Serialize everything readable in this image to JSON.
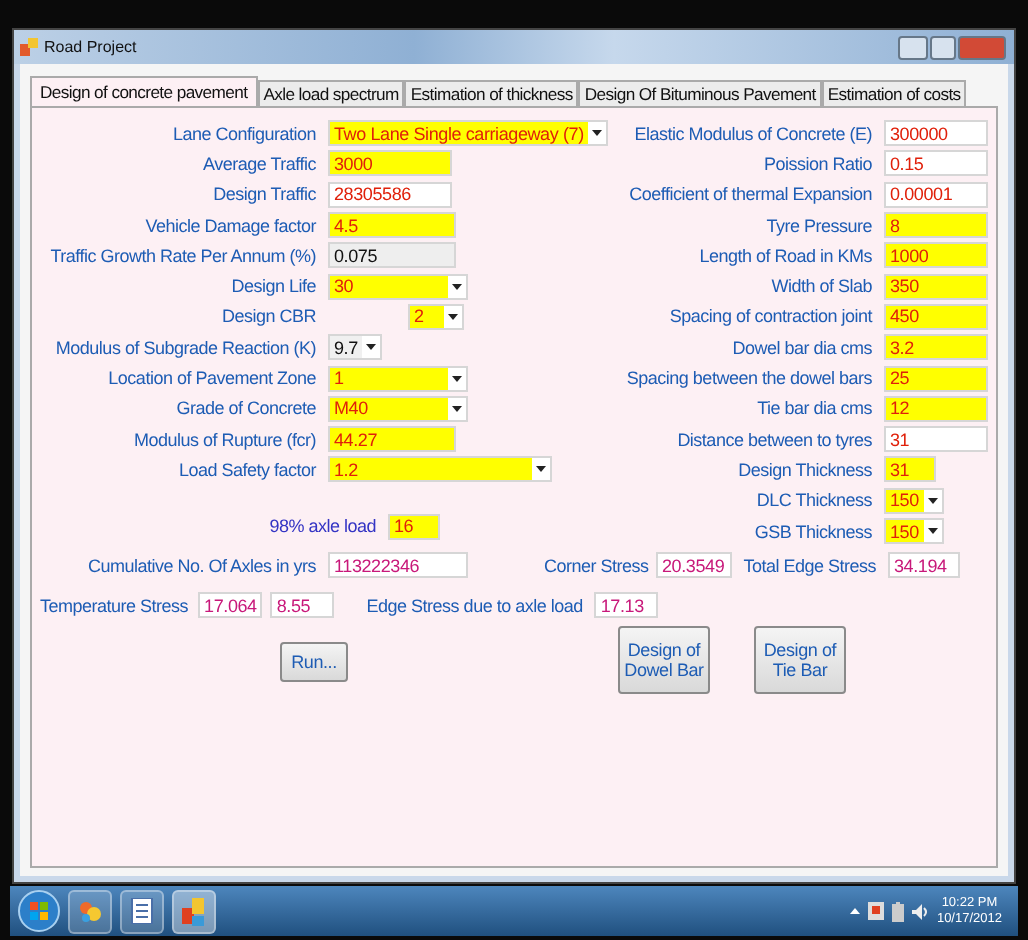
{
  "window": {
    "title": "Road Project"
  },
  "tabs": [
    {
      "label": "Design of concrete pavement",
      "selected": true
    },
    {
      "label": "Axle load spectrum",
      "selected": false
    },
    {
      "label": "Estimation of thickness",
      "selected": false
    },
    {
      "label": "Design Of Bituminous Pavement",
      "selected": false
    },
    {
      "label": "Estimation of costs",
      "selected": false
    }
  ],
  "left_fields": [
    {
      "label": "Lane Configuration",
      "value": "Two Lane Single carriageway (7)",
      "kind": "input",
      "dropdown": true
    },
    {
      "label": "Average Traffic",
      "value": "3000",
      "kind": "input",
      "dropdown": false
    },
    {
      "label": "Design Traffic",
      "value": "28305586",
      "kind": "output",
      "dropdown": false
    },
    {
      "label": "Vehicle Damage factor",
      "value": "4.5",
      "kind": "input",
      "dropdown": false
    },
    {
      "label": "Traffic Growth Rate Per Annum (%)",
      "value": "0.075",
      "kind": "readonly",
      "dropdown": false
    },
    {
      "label": "Design Life",
      "value": "30",
      "kind": "input",
      "dropdown": true
    },
    {
      "label": "Design CBR",
      "value": "2",
      "kind": "input",
      "dropdown": true
    },
    {
      "label": "Modulus of Subgrade Reaction (K)",
      "value": "9.7",
      "kind": "plain",
      "dropdown": true
    },
    {
      "label": "Location of Pavement Zone",
      "value": "1",
      "kind": "input",
      "dropdown": true
    },
    {
      "label": "Grade of Concrete",
      "value": "M40",
      "kind": "input",
      "dropdown": true
    },
    {
      "label": "Modulus of Rupture (fcr)",
      "value": "44.27",
      "kind": "input",
      "dropdown": false
    },
    {
      "label": "Load Safety factor",
      "value": "1.2",
      "kind": "input",
      "dropdown": true
    }
  ],
  "right_fields": [
    {
      "label": "Elastic Modulus of Concrete (E)",
      "value": "300000",
      "kind": "output",
      "dropdown": false
    },
    {
      "label": "Poission Ratio",
      "value": "0.15",
      "kind": "output",
      "dropdown": false
    },
    {
      "label": "Coefficient of thermal Expansion",
      "value": "0.00001",
      "kind": "output",
      "dropdown": false
    },
    {
      "label": "Tyre Pressure",
      "value": "8",
      "kind": "input",
      "dropdown": false
    },
    {
      "label": "Length of Road in KMs",
      "value": "1000",
      "kind": "input",
      "dropdown": false
    },
    {
      "label": "Width of Slab",
      "value": "350",
      "kind": "input",
      "dropdown": false
    },
    {
      "label": "Spacing of contraction joint",
      "value": "450",
      "kind": "input",
      "dropdown": false
    },
    {
      "label": "Dowel bar dia cms",
      "value": "3.2",
      "kind": "input",
      "dropdown": false
    },
    {
      "label": "Spacing between the dowel bars",
      "value": "25",
      "kind": "input",
      "dropdown": false
    },
    {
      "label": "Tie bar dia cms",
      "value": "12",
      "kind": "input",
      "dropdown": false
    },
    {
      "label": "Distance between to tyres",
      "value": "31",
      "kind": "output",
      "dropdown": false
    },
    {
      "label": "Design Thickness",
      "value": "31",
      "kind": "input",
      "dropdown": false
    },
    {
      "label": "DLC Thickness",
      "value": "150",
      "kind": "input",
      "dropdown": true
    },
    {
      "label": "GSB Thickness",
      "value": "150",
      "kind": "input",
      "dropdown": true
    }
  ],
  "axle_load": {
    "label": "98% axle load",
    "value": "16",
    "kind": "input"
  },
  "cumulative_axles": {
    "label": "Cumulative No. Of Axles in yrs",
    "value": "113222346",
    "kind": "result"
  },
  "corner_stress": {
    "label": "Corner Stress",
    "value": "20.3549",
    "kind": "result"
  },
  "total_edge_stress": {
    "label": "Total Edge Stress",
    "value": "34.194",
    "kind": "result"
  },
  "temperature_stress": {
    "label": "Temperature Stress",
    "values": [
      "17.064",
      "8.55"
    ]
  },
  "edge_stress": {
    "label": "Edge Stress due to axle load",
    "value": "17.13",
    "kind": "result"
  },
  "buttons": [
    {
      "label": "Run..."
    },
    {
      "label": "Design of Dowel Bar"
    },
    {
      "label": "Design of Tie Bar"
    }
  ],
  "taskbar": {
    "time": "10:22 PM",
    "date": "10/17/2012"
  }
}
